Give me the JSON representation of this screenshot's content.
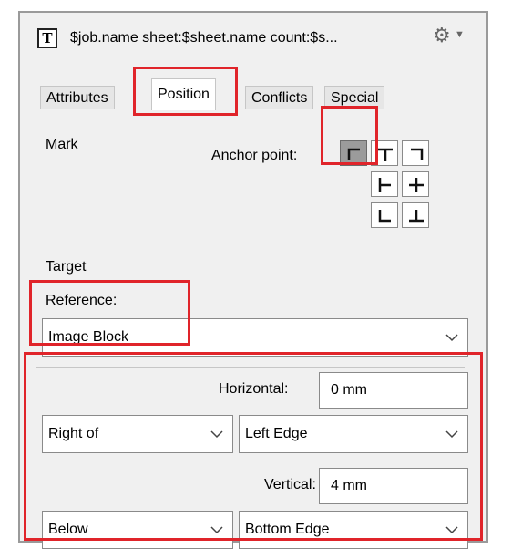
{
  "header": {
    "title": "$job.name sheet:$sheet.name count:$s...",
    "type_icon": "T",
    "menu_icon": "gear-icon"
  },
  "tabs": [
    {
      "label": "Attributes",
      "active": false
    },
    {
      "label": "Position",
      "active": true
    },
    {
      "label": "Conflicts",
      "active": false
    },
    {
      "label": "Special",
      "active": false
    }
  ],
  "mark": {
    "section_label": "Mark",
    "anchor_label": "Anchor point:",
    "anchor_selected": "top-left"
  },
  "target": {
    "section_label": "Target",
    "reference_label": "Reference:",
    "reference_value": "Image Block",
    "horizontal_label": "Horizontal:",
    "horizontal_value": "0 mm",
    "horizontal_relation": "Right of",
    "horizontal_edge": "Left Edge",
    "vertical_label": "Vertical:",
    "vertical_value": "4 mm",
    "vertical_relation": "Below",
    "vertical_edge": "Bottom Edge"
  },
  "colors": {
    "highlight": "#e0242a",
    "panel_bg": "#f0f0f0"
  }
}
